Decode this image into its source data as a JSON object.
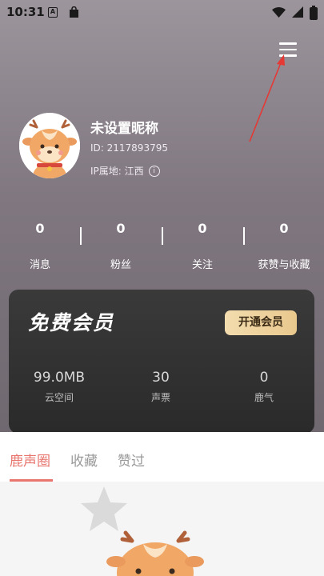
{
  "status_bar": {
    "time": "10:31",
    "app_icon_text": "A"
  },
  "header": {
    "menu_icon": "hamburger-menu-icon"
  },
  "profile": {
    "nickname": "未设置昵称",
    "id_text": "ID: 2117893795",
    "ip_text": "IP属地: 江西",
    "info_icon_glyph": "i"
  },
  "stats": [
    {
      "value": "0",
      "label": "消息"
    },
    {
      "value": "0",
      "label": "粉丝"
    },
    {
      "value": "0",
      "label": "关注"
    },
    {
      "value": "0",
      "label": "获赞与收藏"
    }
  ],
  "vip": {
    "title": "免费会员",
    "open_button": "开通会员",
    "items": [
      {
        "value": "99.0MB",
        "label": "云空间"
      },
      {
        "value": "30",
        "label": "声票"
      },
      {
        "value": "0",
        "label": "鹿气"
      }
    ]
  },
  "tabs": [
    {
      "label": "鹿声圈",
      "active": true
    },
    {
      "label": "收藏",
      "active": false
    },
    {
      "label": "赞过",
      "active": false
    }
  ],
  "colors": {
    "accent": "#e8756e",
    "vip_gold": "#e9c88d",
    "annotation_arrow": "#e53935"
  }
}
